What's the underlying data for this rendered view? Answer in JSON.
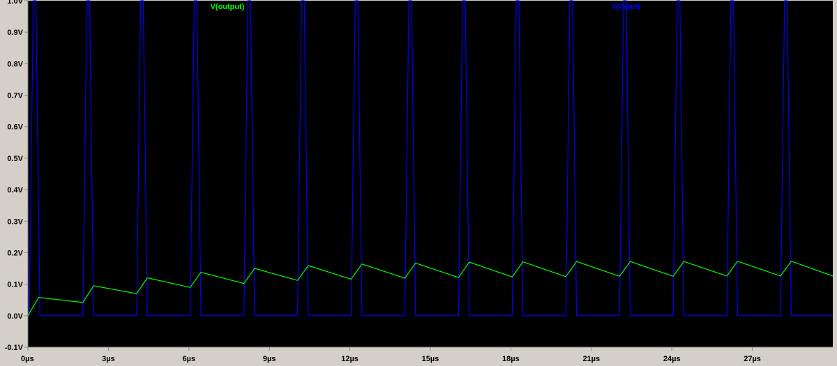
{
  "chart_data": {
    "type": "line",
    "title": "",
    "xlabel": "",
    "ylabel": "",
    "xlim": [
      0,
      30
    ],
    "ylim": [
      -0.1,
      1.0
    ],
    "x_unit": "µs",
    "y_ticks": [
      {
        "value": 1.0,
        "label": "1.0V"
      },
      {
        "value": 0.9,
        "label": "0.9V"
      },
      {
        "value": 0.8,
        "label": "0.8V"
      },
      {
        "value": 0.7,
        "label": "0.7V"
      },
      {
        "value": 0.6,
        "label": "0.6V"
      },
      {
        "value": 0.5,
        "label": "0.5V"
      },
      {
        "value": 0.4,
        "label": "0.4V"
      },
      {
        "value": 0.3,
        "label": "0.3V"
      },
      {
        "value": 0.2,
        "label": "0.2V"
      },
      {
        "value": 0.1,
        "label": "0.1V"
      },
      {
        "value": 0.0,
        "label": "0.0V"
      },
      {
        "value": -0.1,
        "label": "-0.1V"
      }
    ],
    "x_ticks": [
      {
        "value": 0,
        "label": "0µs"
      },
      {
        "value": 3,
        "label": "3µs"
      },
      {
        "value": 6,
        "label": "6µs"
      },
      {
        "value": 9,
        "label": "9µs"
      },
      {
        "value": 12,
        "label": "12µs"
      },
      {
        "value": 15,
        "label": "15µs"
      },
      {
        "value": 18,
        "label": "18µs"
      },
      {
        "value": 21,
        "label": "21µs"
      },
      {
        "value": 24,
        "label": "24µs"
      },
      {
        "value": 27,
        "label": "27µs"
      }
    ],
    "grid": false,
    "colors": {
      "plot_background": "#000000",
      "window_background": "#d4d0c8",
      "axis": "#888888",
      "output": "#00ff00",
      "input": "#0000ff"
    },
    "series": [
      {
        "name": "V(output)",
        "color": "#00ff00",
        "x": [
          0.0,
          0.4,
          2.05,
          2.45,
          4.05,
          4.45,
          6.05,
          6.45,
          8.05,
          8.45,
          10.05,
          10.45,
          12.05,
          12.45,
          14.05,
          14.45,
          16.05,
          16.45,
          18.05,
          18.45,
          20.05,
          20.45,
          22.05,
          22.45,
          24.05,
          24.45,
          26.05,
          26.45,
          28.05,
          28.45,
          30.0
        ],
        "y": [
          0.0,
          0.058,
          0.042,
          0.095,
          0.07,
          0.12,
          0.09,
          0.138,
          0.102,
          0.15,
          0.112,
          0.159,
          0.116,
          0.164,
          0.119,
          0.167,
          0.121,
          0.17,
          0.123,
          0.171,
          0.124,
          0.172,
          0.125,
          0.172,
          0.125,
          0.172,
          0.126,
          0.173,
          0.126,
          0.173,
          0.126
        ]
      },
      {
        "name": "V(input)",
        "color": "#0000ff",
        "x": [
          0.0,
          0.05,
          0.2,
          0.3,
          0.45,
          2.05,
          2.2,
          2.3,
          2.45,
          4.05,
          4.2,
          4.3,
          4.45,
          6.05,
          6.2,
          6.3,
          6.45,
          8.05,
          8.2,
          8.3,
          8.45,
          10.05,
          10.2,
          10.3,
          10.45,
          12.05,
          12.2,
          12.3,
          12.45,
          14.05,
          14.2,
          14.3,
          14.45,
          16.05,
          16.2,
          16.3,
          16.45,
          18.05,
          18.2,
          18.3,
          18.45,
          20.05,
          20.2,
          20.3,
          20.45,
          22.05,
          22.2,
          22.3,
          22.45,
          24.05,
          24.2,
          24.3,
          24.45,
          26.05,
          26.2,
          26.3,
          26.45,
          28.05,
          28.2,
          28.3,
          28.45,
          30.0
        ],
        "y": [
          0,
          0,
          1,
          1,
          0,
          0,
          1,
          1,
          0,
          0,
          1,
          1,
          0,
          0,
          1,
          1,
          0,
          0,
          1,
          1,
          0,
          0,
          1,
          1,
          0,
          0,
          1,
          1,
          0,
          0,
          1,
          1,
          0,
          0,
          1,
          1,
          0,
          0,
          1,
          1,
          0,
          0,
          1,
          1,
          0,
          0,
          1,
          1,
          0,
          0,
          1,
          1,
          0,
          0,
          1,
          1,
          0,
          0,
          1,
          1,
          0,
          0
        ]
      }
    ]
  }
}
